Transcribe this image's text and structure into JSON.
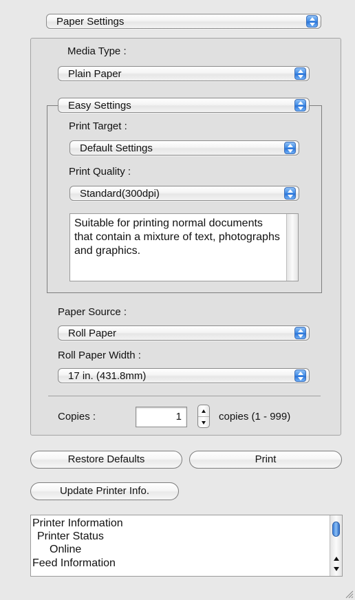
{
  "top_popup": {
    "label": "Paper Settings"
  },
  "media_type": {
    "label": "Media Type :",
    "value": "Plain Paper"
  },
  "easy_settings": {
    "label": "Easy Settings"
  },
  "print_target": {
    "label": "Print Target :",
    "value": "Default Settings"
  },
  "print_quality": {
    "label": "Print Quality :",
    "value": "Standard(300dpi)"
  },
  "description": {
    "text": "Suitable for printing normal documents that contain a mixture of text, photographs and graphics."
  },
  "paper_source": {
    "label": "Paper Source :",
    "value": "Roll Paper"
  },
  "roll_width": {
    "label": "Roll Paper Width :",
    "value": "17 in. (431.8mm)"
  },
  "copies": {
    "label": "Copies :",
    "value": "1",
    "range_label": "copies (1 - 999)"
  },
  "buttons": {
    "restore": "Restore Defaults",
    "print": "Print",
    "update": "Update Printer Info."
  },
  "printer_info": {
    "lines": [
      "Printer Information",
      "Printer Status",
      "Online",
      "Feed Information"
    ]
  },
  "colors": {
    "accent": "#3f8be6",
    "panel": "#e0e0e0",
    "background": "#e8e8e8"
  }
}
